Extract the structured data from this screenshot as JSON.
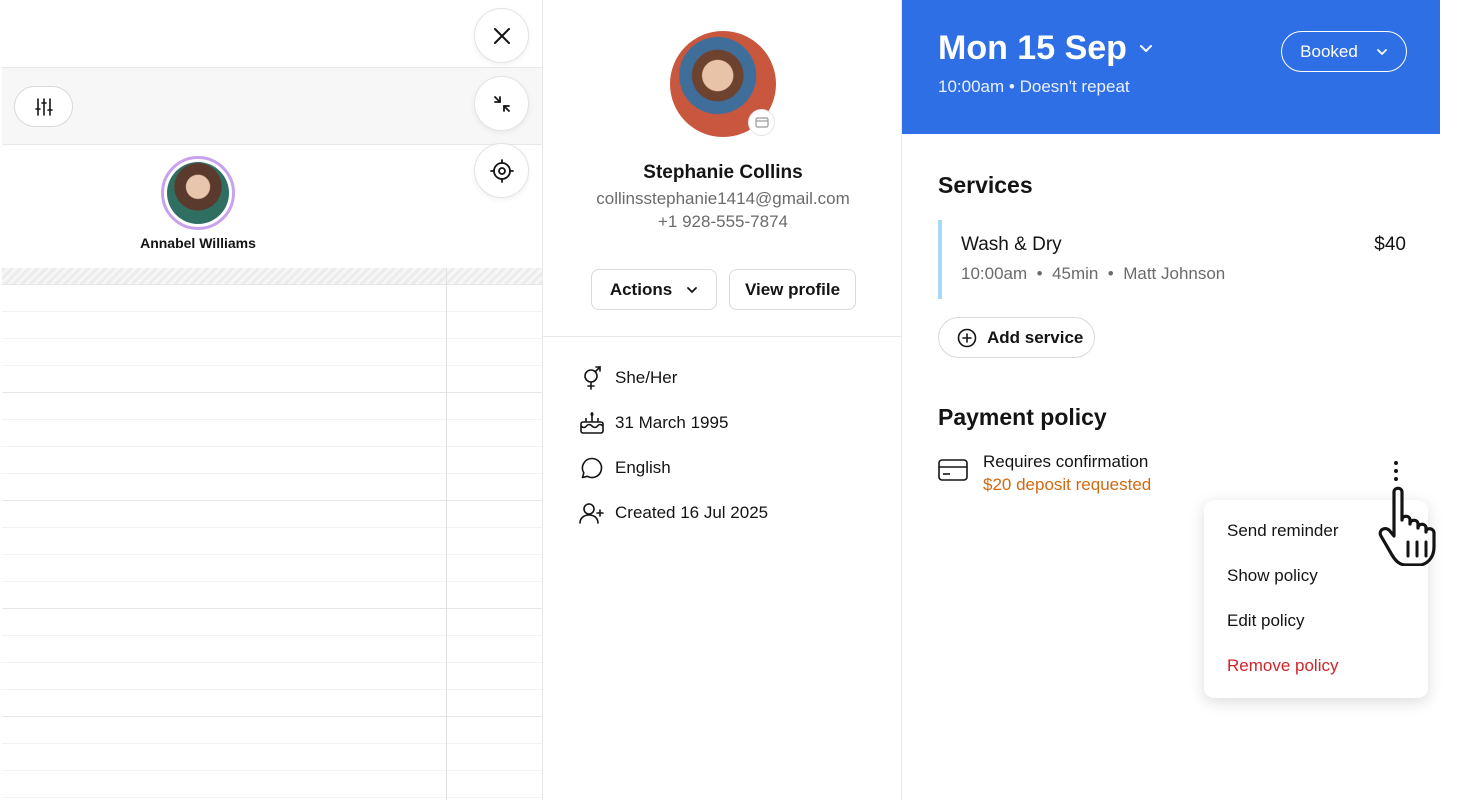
{
  "calendar": {
    "staff_name": "Annabel Williams"
  },
  "client": {
    "name": "Stephanie Collins",
    "email": "collinsstephanie1414@gmail.com",
    "phone": "+1 928-555-7874",
    "actions_label": "Actions",
    "view_profile_label": "View profile",
    "details": [
      {
        "icon": "gender-icon",
        "text": "She/Her"
      },
      {
        "icon": "birthday-cake-icon",
        "text": "31 March 1995"
      },
      {
        "icon": "chat-bubble-icon",
        "text": "English"
      },
      {
        "icon": "add-user-icon",
        "text": "Created 16 Jul 2025"
      }
    ]
  },
  "appointment": {
    "date": "Mon 15 Sep",
    "time": "10:00am",
    "repeat": "Doesn't repeat",
    "status": "Booked",
    "header_color": "#2f6fe6",
    "services_title": "Services",
    "service": {
      "name": "Wash & Dry",
      "price": "$40",
      "time": "10:00am",
      "duration": "45min",
      "staff": "Matt Johnson"
    },
    "add_service_label": "Add service",
    "payment_title": "Payment policy",
    "policy": {
      "title": "Requires confirmation",
      "subtitle": "$20 deposit requested"
    }
  },
  "policy_menu": {
    "items": [
      "Send reminder",
      "Show policy",
      "Edit policy",
      "Remove policy"
    ]
  }
}
